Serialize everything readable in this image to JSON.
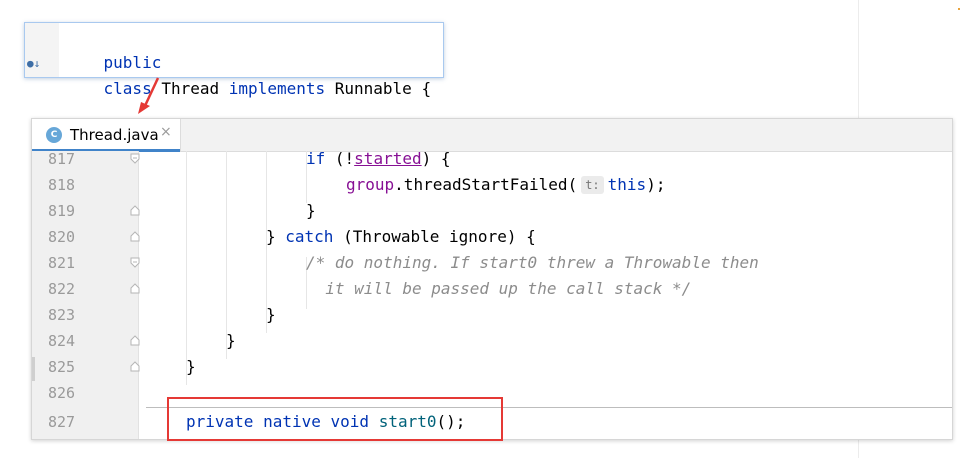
{
  "popup": {
    "line1": "public",
    "line2_kw1": "class",
    "line2_name": "Thread",
    "line2_kw2": "implements",
    "line2_iface": "Runnable {"
  },
  "tab": {
    "icon_letter": "C",
    "label": "Thread.java",
    "close": "×"
  },
  "lines": [
    {
      "num": "817"
    },
    {
      "num": "818"
    },
    {
      "num": "819"
    },
    {
      "num": "820"
    },
    {
      "num": "821"
    },
    {
      "num": "822"
    },
    {
      "num": "823"
    },
    {
      "num": "824"
    },
    {
      "num": "825"
    },
    {
      "num": "826"
    },
    {
      "num": "827"
    }
  ],
  "code": {
    "l817_kw": "if",
    "l817_rest1": " (!",
    "l817_field": "started",
    "l817_rest2": ") {",
    "l818_field": "group",
    "l818_call": ".threadStartFailed(",
    "l818_hint": "t:",
    "l818_this": "this",
    "l818_end": ");",
    "l819": "}",
    "l820_brace": "} ",
    "l820_kw": "catch",
    "l820_rest": " (Throwable ignore) {",
    "l821": "/* do nothing. If start0 threw a Throwable then",
    "l822": "  it will be passed up the call stack */",
    "l823": "}",
    "l824": "}",
    "l825": "}",
    "l827_kw1": "private",
    "l827_kw2": "native",
    "l827_kw3": "void",
    "l827_method": "start0",
    "l827_end": "();"
  },
  "colors": {
    "keyword": "#0033b3",
    "field": "#871094",
    "comment": "#8c8c8c",
    "method": "#00627a",
    "annotation_box": "#e53935",
    "tab_underline": "#4083c9"
  },
  "icons": {
    "popup_gutter": "implemented-interface-icon",
    "tab_file": "java-class-icon"
  }
}
